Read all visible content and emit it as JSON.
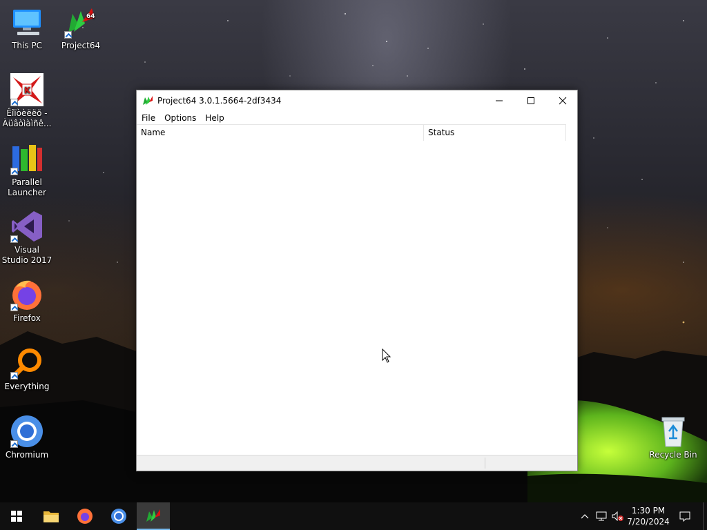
{
  "desktop": {
    "icons": [
      {
        "label": "This PC",
        "icon": "computer-icon"
      },
      {
        "label": "Project64",
        "icon": "project64-icon"
      },
      {
        "label": "Êîïòèëëõ - Àüâòìàìñê...",
        "icon": "kaspersky-icon"
      },
      {
        "label": "Parallel Launcher",
        "icon": "parallel-launcher-icon"
      },
      {
        "label": "Visual Studio 2017",
        "icon": "visual-studio-icon"
      },
      {
        "label": "Firefox",
        "icon": "firefox-icon"
      },
      {
        "label": "Everything",
        "icon": "everything-search-icon"
      },
      {
        "label": "Chromium",
        "icon": "chromium-icon"
      },
      {
        "label": "Recycle Bin",
        "icon": "recycle-bin-icon"
      }
    ]
  },
  "window": {
    "title": "Project64 3.0.1.5664-2df3434",
    "menu": [
      "File",
      "Options",
      "Help"
    ],
    "columns": [
      "Name",
      "Status"
    ],
    "rows": []
  },
  "taskbar": {
    "start_icon": "windows-start-icon",
    "pinned": [
      "file-explorer-icon",
      "firefox-icon",
      "chromium-icon",
      "project64-icon"
    ],
    "active": "project64-icon",
    "tray_icons": [
      "chevron-up-icon",
      "network-icon",
      "volume-muted-icon",
      "notification-icon"
    ],
    "time": "1:30 PM",
    "date": "7/20/2024"
  },
  "colors": {
    "taskbar": "#101010",
    "active_indicator": "#76b9ed",
    "window_bg": "#ffffff"
  }
}
